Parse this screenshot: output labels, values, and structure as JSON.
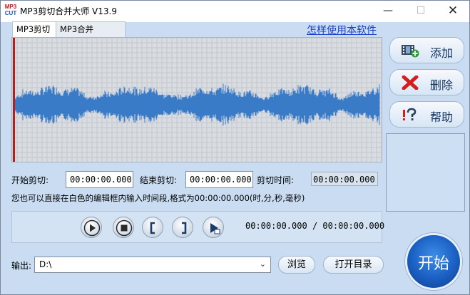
{
  "window": {
    "app_icon": {
      "top": "MP3",
      "bottom": "CUT"
    },
    "title": "MP3剪切合并大师 V13.9",
    "controls": {
      "minimize": "—",
      "maximize": "☐",
      "close": "✕"
    }
  },
  "tabs": [
    {
      "label": "MP3剪切",
      "active": true
    },
    {
      "label": "MP3合并",
      "active": false
    }
  ],
  "help_link": "怎样使用本软件",
  "sidebar": {
    "add": {
      "label": "添加",
      "icon": "film-add-icon"
    },
    "delete": {
      "label": "删除",
      "icon": "red-x-icon"
    },
    "help": {
      "label": "帮助",
      "icon": "question-help-icon"
    }
  },
  "cut": {
    "start_label": "开始剪切:",
    "start_value": "00:00:00.000",
    "end_label": "结束剪切:",
    "end_value": "00:00:00.000",
    "duration_label": "剪切时间:",
    "duration_value": "00:00:00.000",
    "hint": "您也可以直接在白色的编辑框内输入时间段,格式为00:00:00.000(时,分,秒,毫秒)"
  },
  "player": {
    "current_time": "00:00:00.000",
    "separator": "/",
    "total_time": "00:00:00.000"
  },
  "output": {
    "label": "输出:",
    "path": "D:\\",
    "browse_label": "浏览",
    "open_dir_label": "打开目录"
  },
  "start_button": "开始",
  "colors": {
    "window_bg": "#c9dcf1",
    "waveform": "#3a7bc8",
    "start_button": "#1a5fc2",
    "link": "#1a3fc8"
  }
}
